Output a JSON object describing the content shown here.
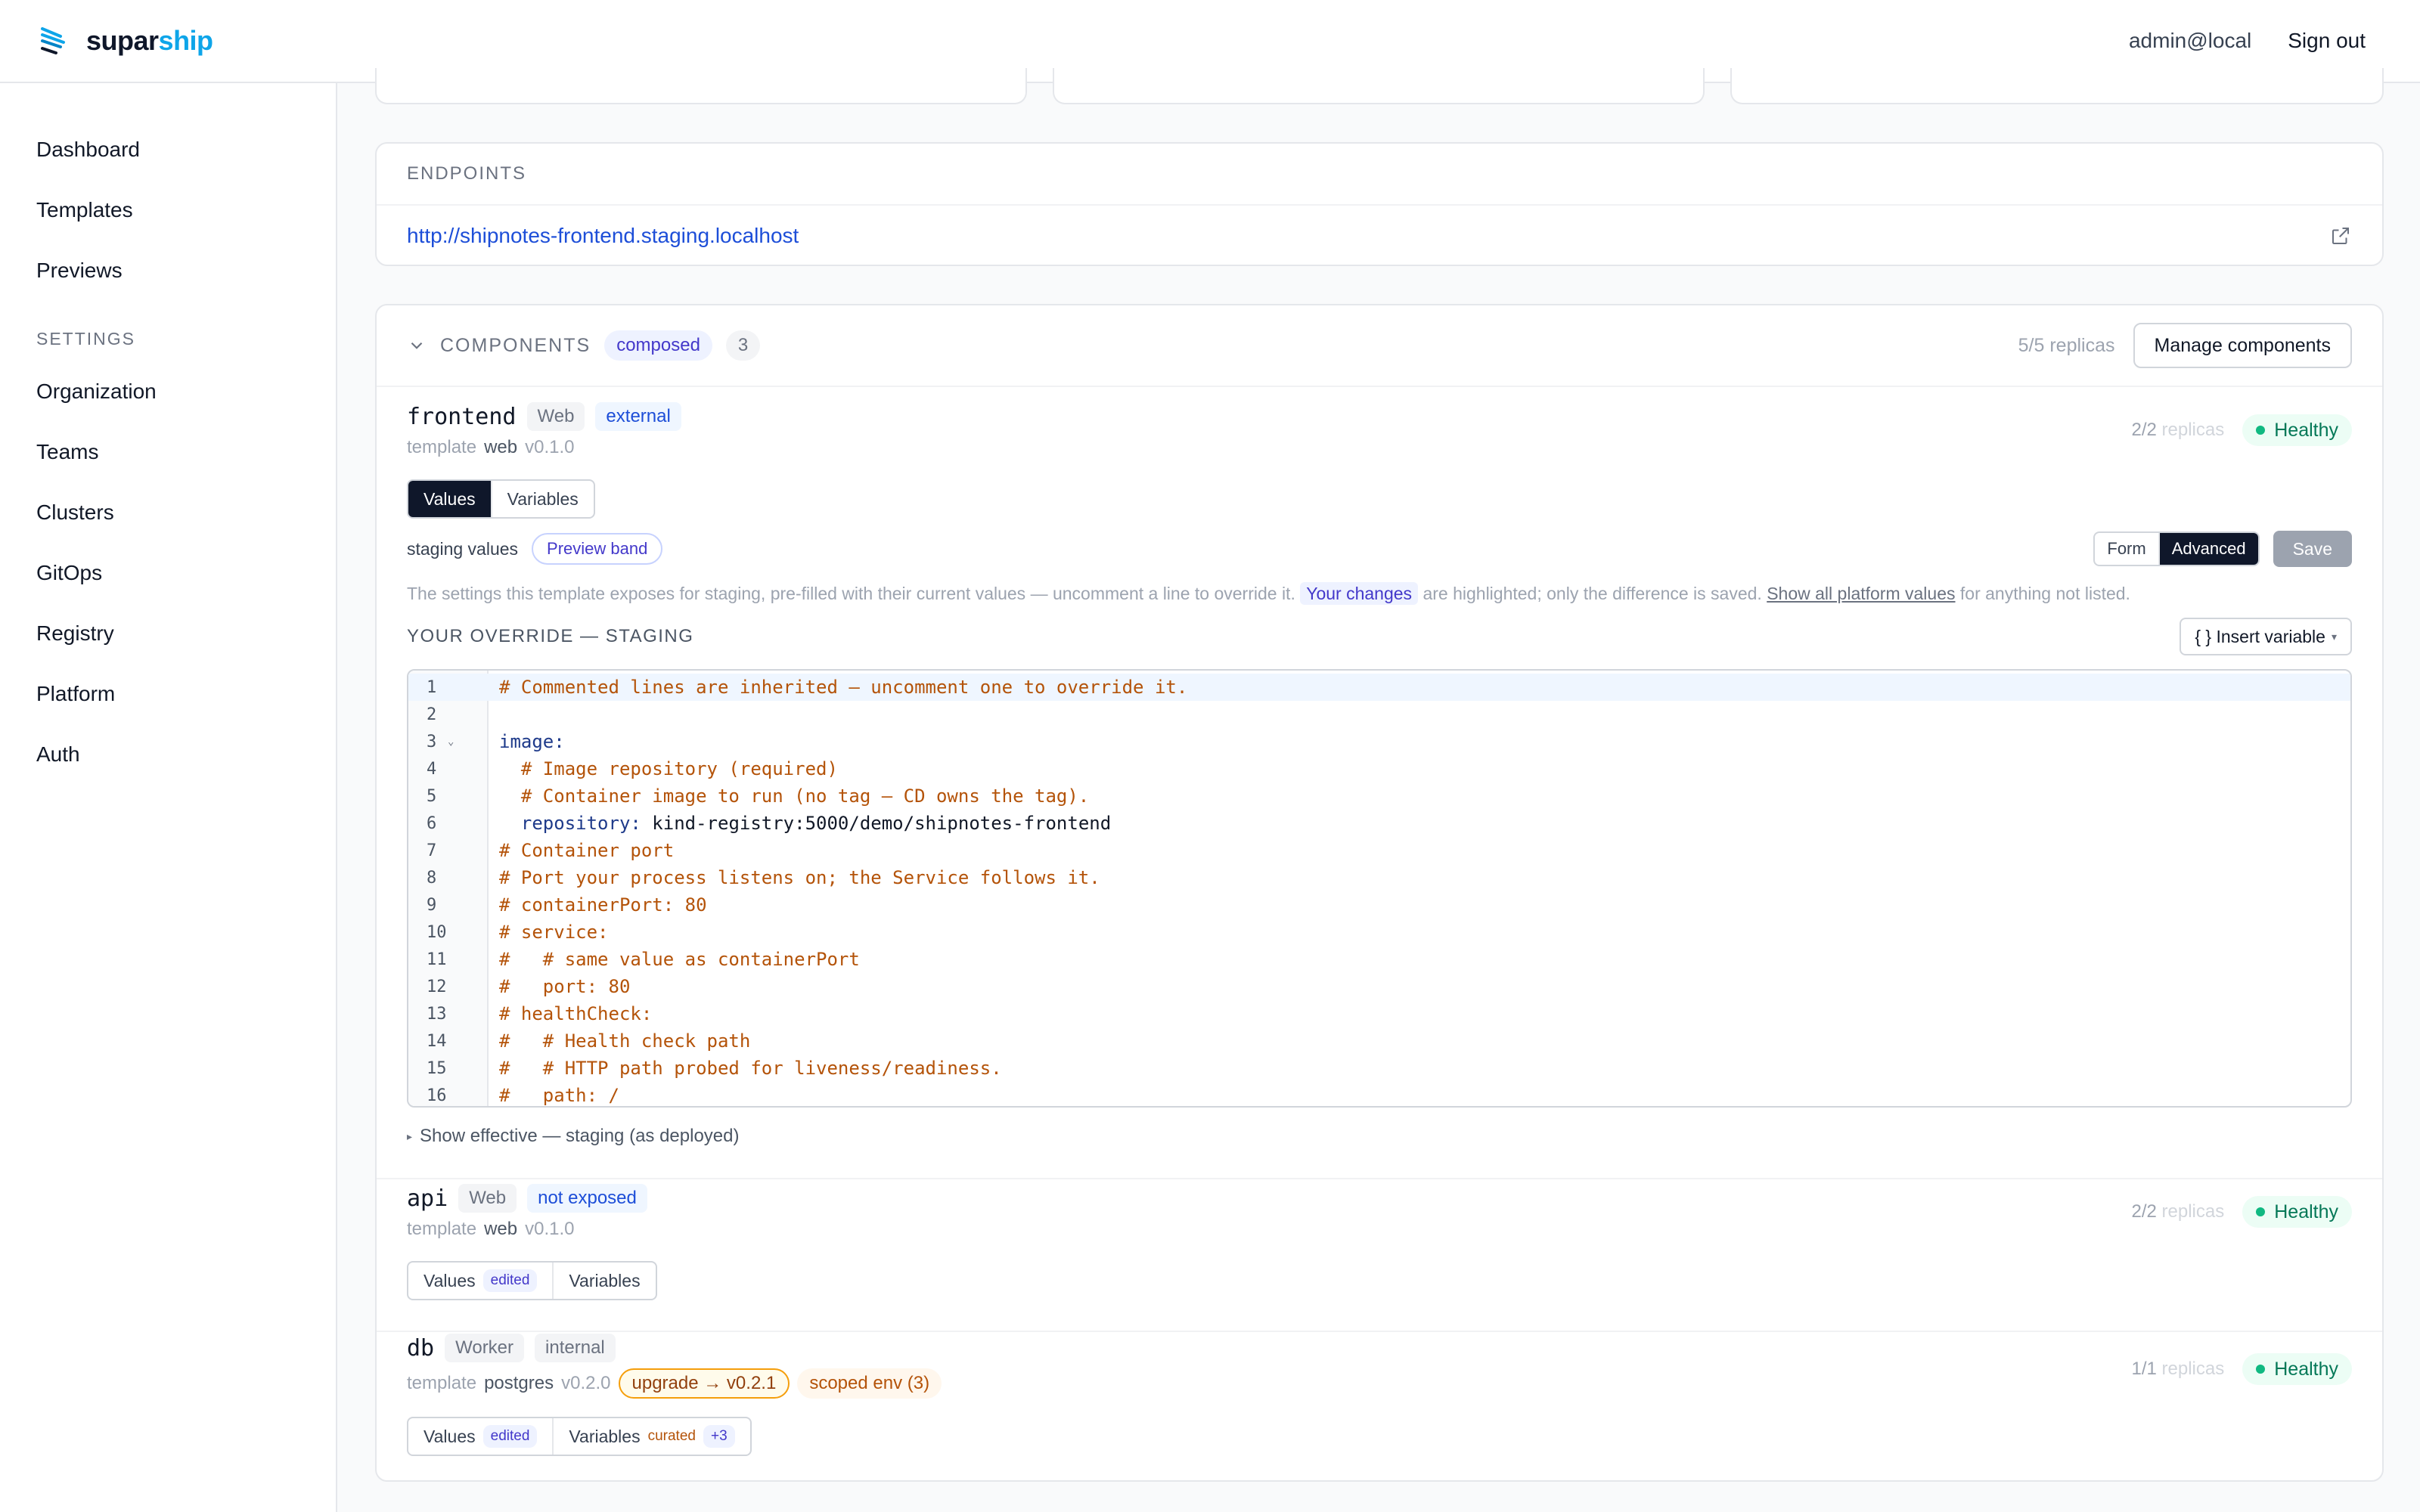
{
  "brand": {
    "name_a": "supar",
    "name_b": "ship"
  },
  "header": {
    "user": "admin@local",
    "sign_out": "Sign out"
  },
  "sidebar": {
    "items": [
      "Dashboard",
      "Templates",
      "Previews"
    ],
    "settings_label": "SETTINGS",
    "settings_items": [
      "Organization",
      "Teams",
      "Clusters",
      "GitOps",
      "Registry",
      "Platform",
      "Auth"
    ]
  },
  "endpoints": {
    "title": "ENDPOINTS",
    "url": "http://shipnotes-frontend.staging.localhost"
  },
  "components": {
    "title": "COMPONENTS",
    "mode_badge": "composed",
    "count": "3",
    "replicas": "5/5 replicas",
    "manage_label": "Manage components",
    "frontend": {
      "name": "frontend",
      "kind": "Web",
      "exposure": "external",
      "tpl_prefix": "template",
      "tpl_name": "web",
      "tpl_version": "v0.1.0",
      "replicas_count": "2/2",
      "replicas_label": "replicas",
      "status": "Healthy",
      "tabs": {
        "values": "Values",
        "variables": "Variables"
      },
      "values_label": "staging values",
      "preview_band": "Preview band",
      "mode": {
        "form": "Form",
        "advanced": "Advanced"
      },
      "save": "Save",
      "help_a": "The settings this template exposes for staging, pre-filled with their current values — uncomment a line to override it.",
      "help_hl": "Your changes",
      "help_b": "are highlighted; only the difference is saved.",
      "help_link": "Show all platform values",
      "help_c": "for anything not listed.",
      "override_title": "YOUR OVERRIDE — STAGING",
      "insert_variable": "{ } Insert variable",
      "code": [
        {
          "n": "1",
          "t": "# Commented lines are inherited — uncomment one to override it.",
          "k": "comment"
        },
        {
          "n": "2",
          "t": "",
          "k": "comment"
        },
        {
          "n": "3",
          "t": "image:",
          "k": "key",
          "fold": "⌄"
        },
        {
          "n": "4",
          "t": "  # Image repository (required)",
          "k": "comment"
        },
        {
          "n": "5",
          "t": "  # Container image to run (no tag — CD owns the tag).",
          "k": "comment"
        },
        {
          "n": "6",
          "t": "  repository:",
          "k": "key",
          "v": " kind-registry:5000/demo/shipnotes-frontend"
        },
        {
          "n": "7",
          "t": "# Container port",
          "k": "comment"
        },
        {
          "n": "8",
          "t": "# Port your process listens on; the Service follows it.",
          "k": "comment"
        },
        {
          "n": "9",
          "t": "# containerPort: 80",
          "k": "comment"
        },
        {
          "n": "10",
          "t": "# service:",
          "k": "comment"
        },
        {
          "n": "11",
          "t": "#   # same value as containerPort",
          "k": "comment"
        },
        {
          "n": "12",
          "t": "#   port: 80",
          "k": "comment"
        },
        {
          "n": "13",
          "t": "# healthCheck:",
          "k": "comment"
        },
        {
          "n": "14",
          "t": "#   # Health check path",
          "k": "comment"
        },
        {
          "n": "15",
          "t": "#   # HTTP path probed for liveness/readiness.",
          "k": "comment"
        },
        {
          "n": "16",
          "t": "#   path: /",
          "k": "comment"
        }
      ],
      "show_effective": "Show effective — staging (as deployed)"
    },
    "api": {
      "name": "api",
      "kind": "Web",
      "exposure": "not exposed",
      "tpl_prefix": "template",
      "tpl_name": "web",
      "tpl_version": "v0.1.0",
      "replicas_count": "2/2",
      "replicas_label": "replicas",
      "status": "Healthy",
      "tab_values": "Values",
      "edited": "edited",
      "tab_variables": "Variables"
    },
    "db": {
      "name": "db",
      "kind": "Worker",
      "exposure": "internal",
      "tpl_prefix": "template",
      "tpl_name": "postgres",
      "tpl_version": "v0.2.0",
      "upgrade": "upgrade → v0.2.1",
      "scoped_env": "scoped env (3)",
      "replicas_count": "1/1",
      "replicas_label": "replicas",
      "status": "Healthy",
      "tab_values": "Values",
      "edited": "edited",
      "tab_variables": "Variables",
      "curated": "curated",
      "plus": "+3"
    }
  }
}
